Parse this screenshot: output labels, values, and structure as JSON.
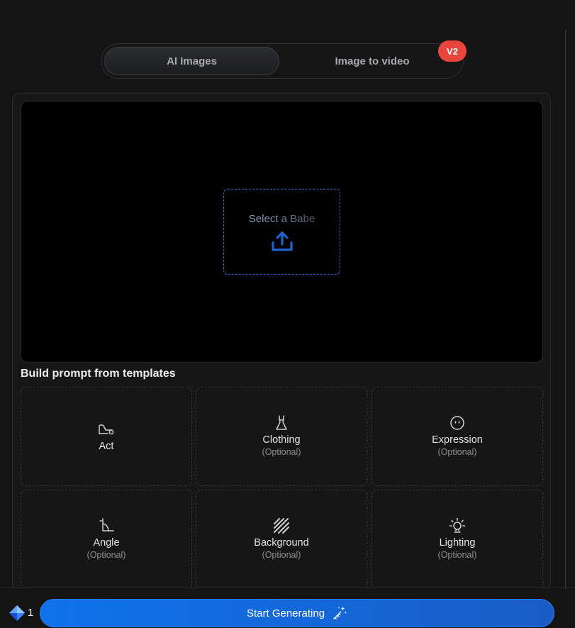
{
  "tabs": {
    "active_label": "AI Images",
    "inactive_label": "Image to video",
    "badge": "V2"
  },
  "preview": {
    "select_label": "Select a Babe",
    "upload_icon": "upload-icon"
  },
  "templates": {
    "title": "Build prompt from templates",
    "cards": [
      {
        "label": "Act",
        "optional": "",
        "icon": "act-icon"
      },
      {
        "label": "Clothing",
        "optional": "(Optional)",
        "icon": "dress-icon"
      },
      {
        "label": "Expression",
        "optional": "(Optional)",
        "icon": "face-icon"
      },
      {
        "label": "Angle",
        "optional": "(Optional)",
        "icon": "angle-icon"
      },
      {
        "label": "Background",
        "optional": "(Optional)",
        "icon": "stripes-icon"
      },
      {
        "label": "Lighting",
        "optional": "(Optional)",
        "icon": "bulb-icon"
      }
    ]
  },
  "footer": {
    "credits": "1",
    "credit_icon": "gem-icon",
    "start_label": "Start Generating",
    "start_icon": "magic-wand-icon"
  },
  "colors": {
    "background": "#141414",
    "accent": "#1566d6",
    "badge": "#e8453c",
    "dashed_border": "#2f6fdc"
  }
}
